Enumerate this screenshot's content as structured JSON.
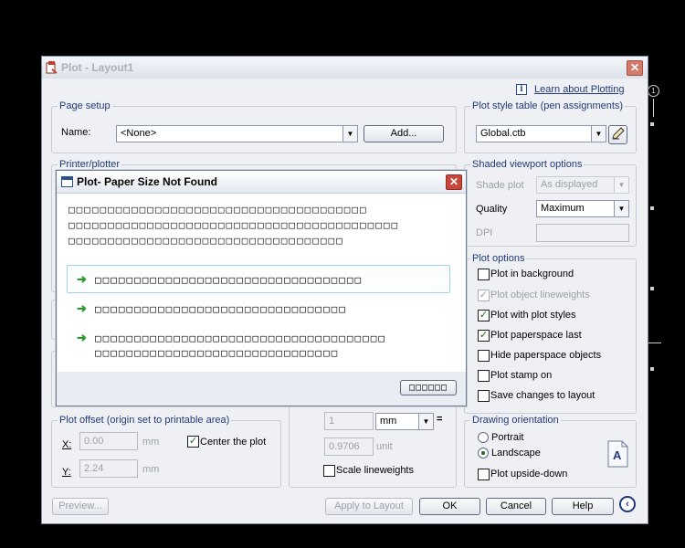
{
  "window": {
    "title": "Plot - Layout1",
    "close_glyph": "✕",
    "help_link": "Learn about Plotting"
  },
  "page_setup": {
    "group_label": "Page setup",
    "name_label": "Name:",
    "name_value": "<None>",
    "add_button": "Add..."
  },
  "printer_plotter": {
    "group_label": "Printer/plotter"
  },
  "plot_style_table": {
    "group_label": "Plot style table (pen assignments)",
    "value": "Global.ctb"
  },
  "shaded_viewport": {
    "group_label": "Shaded viewport options",
    "shade_plot_label": "Shade plot",
    "shade_plot_value": "As displayed",
    "quality_label": "Quality",
    "quality_value": "Maximum",
    "dpi_label": "DPI"
  },
  "plot_options": {
    "group_label": "Plot options",
    "items": [
      {
        "label": "Plot in background",
        "checked": false,
        "disabled": false
      },
      {
        "label": "Plot object lineweights",
        "checked": true,
        "disabled": true
      },
      {
        "label": "Plot with plot styles",
        "checked": true,
        "disabled": false
      },
      {
        "label": "Plot paperspace last",
        "checked": true,
        "disabled": false
      },
      {
        "label": "Hide paperspace objects",
        "checked": false,
        "disabled": false
      },
      {
        "label": "Plot stamp on",
        "checked": false,
        "disabled": false
      },
      {
        "label": "Save changes to layout",
        "checked": false,
        "disabled": false
      }
    ]
  },
  "drawing_orientation": {
    "group_label": "Drawing orientation",
    "portrait": "Portrait",
    "landscape": "Landscape",
    "upside_down": "Plot upside-down"
  },
  "plot_offset": {
    "group_label": "Plot offset (origin set to printable area)",
    "x_label": "X:",
    "x_value": "0.00",
    "y_label": "Y:",
    "y_value": "2.24",
    "unit": "mm",
    "center_label": "Center the plot"
  },
  "plot_scale": {
    "value1": "1",
    "unit_value": "mm",
    "equals": "=",
    "value2": "0.9706",
    "unit2": "unit",
    "scale_lineweights": "Scale lineweights"
  },
  "footer": {
    "preview": "Preview...",
    "apply": "Apply to Layout",
    "ok": "OK",
    "cancel": "Cancel",
    "help": "Help"
  },
  "error_dialog": {
    "title": "Plot- Paper Size Not Found",
    "close_glyph": "✕",
    "message_lines": [
      "□□□□□□□□□□□□□□□□□□□□□□□□□□□□□□□□□□□□□□",
      "□□□□□□□□□□□□□□□□□□□□□□□□□□□□□□□□□□□□□□□□□□",
      "□□□□□□□□□□□□□□□□□□□□□□□□□□□□□□□□□□□"
    ],
    "options": [
      {
        "text": "□□□□□□□□□□□□□□□□□□□□□□□□□□□□□□□□□□",
        "text2": ""
      },
      {
        "text": "□□□□□□□□□□□□□□□□□□□□□□□□□□□□□□□□",
        "text2": ""
      },
      {
        "text": "□□□□□□□□□□□□□□□□□□□□□□□□□□□□□□□□□□□□□",
        "text2": "□□□□□□□□□□□□□□□□□□□□□□□□□□□□□□□"
      }
    ],
    "button": "□□□□□□"
  }
}
